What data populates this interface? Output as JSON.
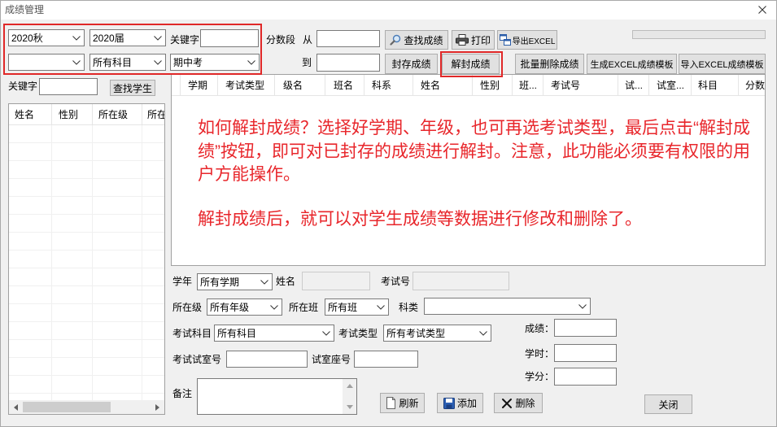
{
  "window": {
    "title": "成绩管理",
    "close_icon": "close-icon"
  },
  "filters": {
    "term": {
      "value": "2020秋"
    },
    "grade": {
      "value": "2020届"
    },
    "subject": {
      "value": "所有科目"
    },
    "exam_type": {
      "value": "期中考"
    },
    "keyword": {
      "label": "关键字"
    }
  },
  "score_range": {
    "label": "分数段",
    "from_label": "从",
    "to_label": "到"
  },
  "toolbar": {
    "search_scores": {
      "label": "查找成绩",
      "icon": "search-icon"
    },
    "print": {
      "label": "打印",
      "icon": "printer-icon"
    },
    "export_excel": {
      "label": "导出EXCEL",
      "icon": "export-icon"
    },
    "seal_scores": {
      "label": "封存成绩"
    },
    "unseal_scores": {
      "label": "解封成绩"
    },
    "batch_delete": {
      "label": "批量删除成绩"
    },
    "generate_template": {
      "label": "生成EXCEL成绩模板"
    },
    "import_template": {
      "label": "导入EXCEL成绩模板"
    }
  },
  "progress_bar": {
    "value": 0
  },
  "student_search": {
    "keyword_label": "关键字",
    "button": "查找学生"
  },
  "student_list": {
    "columns": [
      "姓名",
      "性别",
      "所在级",
      "所在"
    ]
  },
  "scores_grid": {
    "columns": [
      "学期",
      "考试类型",
      "级名",
      "班名",
      "科系",
      "姓名",
      "性别",
      "班...",
      "考试号",
      "试...",
      "试室...",
      "科目",
      "分数"
    ]
  },
  "annotation": {
    "paragraph_1": [
      "如何解封成绩？选择好学期、年级，也可再选考试类型，最后点击“解封成",
      "绩”按钮，即可对已封存的成绩进行解封。注意，此功能必须要有权限的用",
      "户方能操作。"
    ],
    "paragraph_2": [
      "解封成绩后，就可以对学生成绩等数据进行修改和删除了。"
    ]
  },
  "form": {
    "school_year": {
      "label": "学年",
      "value": "所有学期"
    },
    "name": {
      "label": "姓名"
    },
    "exam_no": {
      "label": "考试号"
    },
    "grade": {
      "label": "所在级",
      "value": "所有年级"
    },
    "class": {
      "label": "所在班",
      "value": "所有班"
    },
    "category": {
      "label": "科类"
    },
    "exam_subject": {
      "label": "考试科目",
      "value": "所有科目"
    },
    "exam_type": {
      "label": "考试类型",
      "value": "所有考试类型"
    },
    "exam_room": {
      "label": "考试试室号"
    },
    "seat_no": {
      "label": "试室座号"
    },
    "score": {
      "label": "成绩："
    },
    "hours": {
      "label": "学时："
    },
    "credits": {
      "label": "学分："
    },
    "remark": {
      "label": "备注"
    }
  },
  "actions": {
    "refresh": {
      "label": "刷新",
      "icon": "document-icon"
    },
    "add": {
      "label": "添加",
      "icon": "save-icon"
    },
    "delete": {
      "label": "删除",
      "icon": "delete-icon"
    },
    "close": {
      "label": "关闭"
    }
  },
  "colors": {
    "annotation_text": "#e8262b",
    "highlight_box": "#e02828",
    "window_bg": "#f0f0f0",
    "button_bg": "#e1e1e1"
  }
}
